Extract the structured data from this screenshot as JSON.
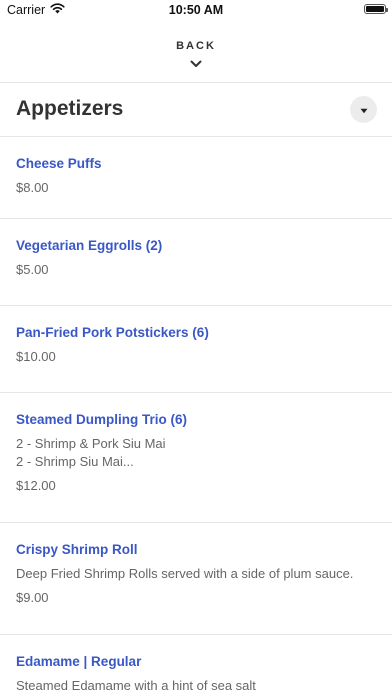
{
  "status_bar": {
    "carrier": "Carrier",
    "time": "10:50 AM",
    "battery_level": 1.0
  },
  "nav": {
    "back_label": "BACK"
  },
  "section": {
    "title": "Appetizers"
  },
  "items": [
    {
      "name": "Cheese Puffs",
      "description": "",
      "price": "$8.00"
    },
    {
      "name": "Vegetarian Eggrolls (2)",
      "description": "",
      "price": "$5.00"
    },
    {
      "name": "Pan-Fried Pork Potstickers (6)",
      "description": "",
      "price": "$10.00"
    },
    {
      "name": "Steamed Dumpling Trio (6)",
      "description": "2 - Shrimp & Pork Siu Mai\n2 - Shrimp Siu Mai...",
      "price": "$12.00"
    },
    {
      "name": "Crispy Shrimp Roll",
      "description": "Deep Fried Shrimp Rolls served with a side of plum sauce.",
      "price": "$9.00"
    },
    {
      "name": "Edamame | Regular",
      "description": "Steamed Edamame with a hint of sea salt",
      "price": ""
    }
  ],
  "colors": {
    "item_name": "#3a57c6",
    "text_secondary": "#666666",
    "divider": "#e6e6e6"
  }
}
